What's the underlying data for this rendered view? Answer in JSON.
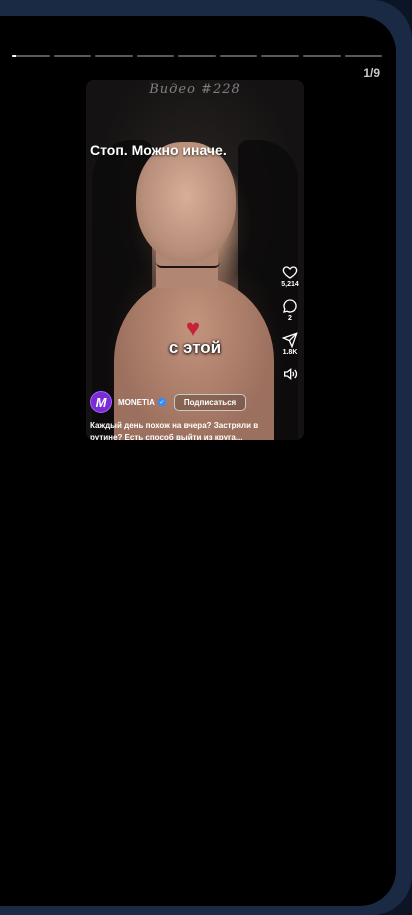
{
  "story": {
    "counter": "1/9",
    "segments": 9,
    "active_segment": 0,
    "active_progress": 0.1
  },
  "video": {
    "watermark": "Видео #228",
    "headline": "Стоп. Можно иначе.",
    "subtitle": "с этой"
  },
  "actions": {
    "likes": "5,214",
    "comments": "2",
    "shares": "1.8K"
  },
  "author": {
    "avatar_letter": "M",
    "name": "MONETIA",
    "follow_label": "Подписаться"
  },
  "caption": "Каждый день похож на вчера? Застряли в рутине? Есть способ выйти из круга...",
  "colors": {
    "avatar": "#7b2bd6",
    "verified": "#2e8cff",
    "frame": "#1a2a44"
  }
}
